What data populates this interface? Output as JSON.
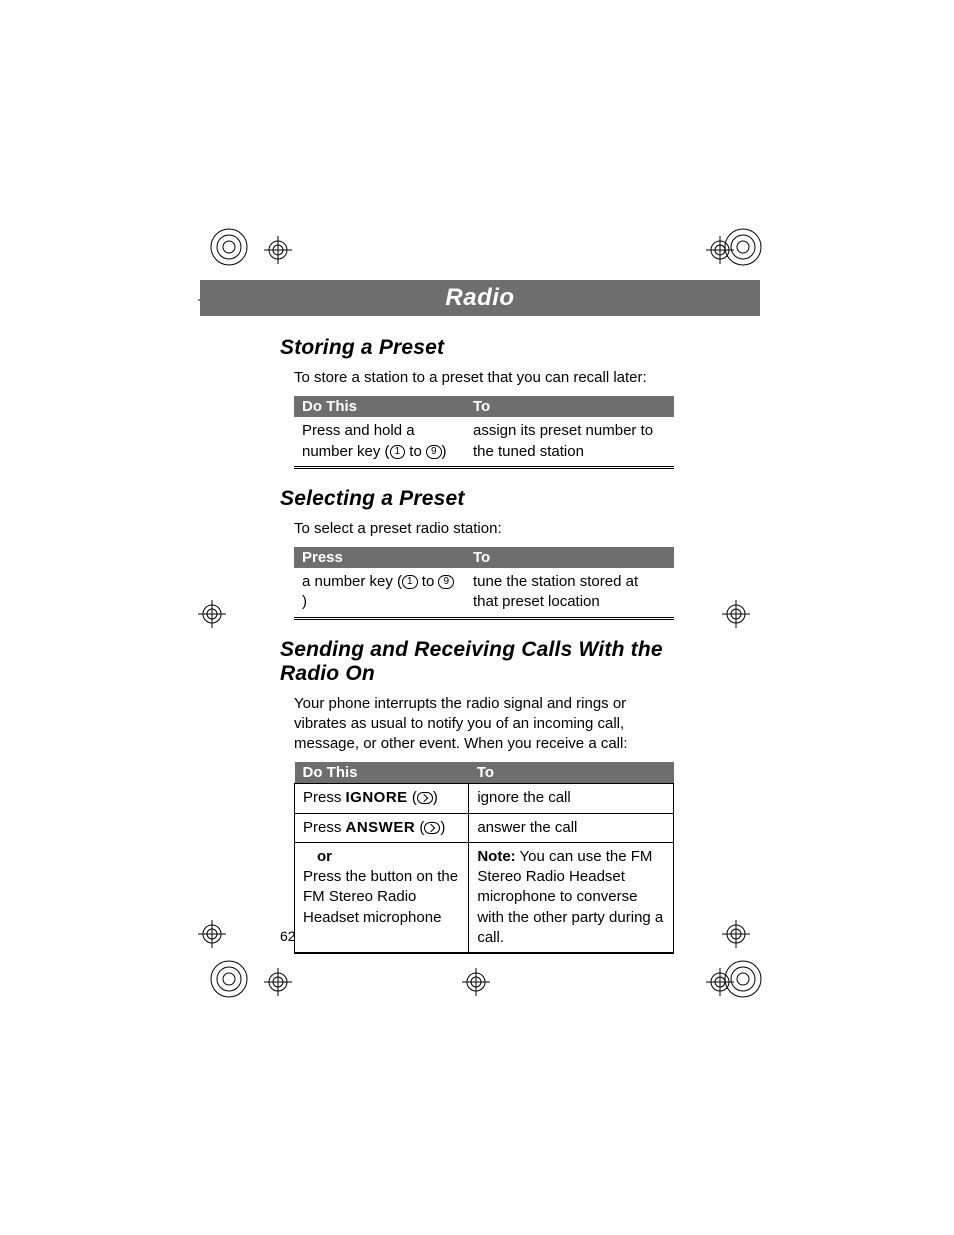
{
  "header": {
    "title": "Radio"
  },
  "page_number": "62",
  "sections": {
    "storing": {
      "heading": "Storing a Preset",
      "intro": "To store a station to a preset that you can recall later:",
      "th1": "Do This",
      "th2": "To",
      "row1a_pre": "Press and hold a number key (",
      "row1a_mid": " to ",
      "row1a_post": ")",
      "row1b": "assign its preset number to the tuned station",
      "key1": "1",
      "key9": "9"
    },
    "selecting": {
      "heading": "Selecting a Preset",
      "intro": "To select a preset radio station:",
      "th1": "Press",
      "th2": "To",
      "row1a_pre": "a number key (",
      "row1a_mid": " to ",
      "row1a_post": ")",
      "row1b": "tune the station stored at that preset location",
      "key1": "1",
      "key9": "9"
    },
    "calls": {
      "heading": "Sending and Receiving Calls With the Radio On",
      "intro": "Your phone interrupts the radio signal and rings or vibrates as usual to notify you of an incoming call, message, or other event. When you receive a call:",
      "th1": "Do This",
      "th2": "To",
      "r1a_pre": "Press ",
      "r1a_label": "IGNORE",
      "r1a_post": " (",
      "r1a_close": ")",
      "r1b": "ignore the call",
      "r2a_pre": "Press ",
      "r2a_label": "ANSWER",
      "r2a_post": " (",
      "r2a_close": ")",
      "r2b": "answer the call",
      "r3_or": "or",
      "r3a": "Press the button on the FM Stereo Radio Headset microphone",
      "r3b_note": "Note:",
      "r3b_rest": " You can use the FM Stereo Radio Headset microphone to converse with the other party during a call."
    }
  }
}
